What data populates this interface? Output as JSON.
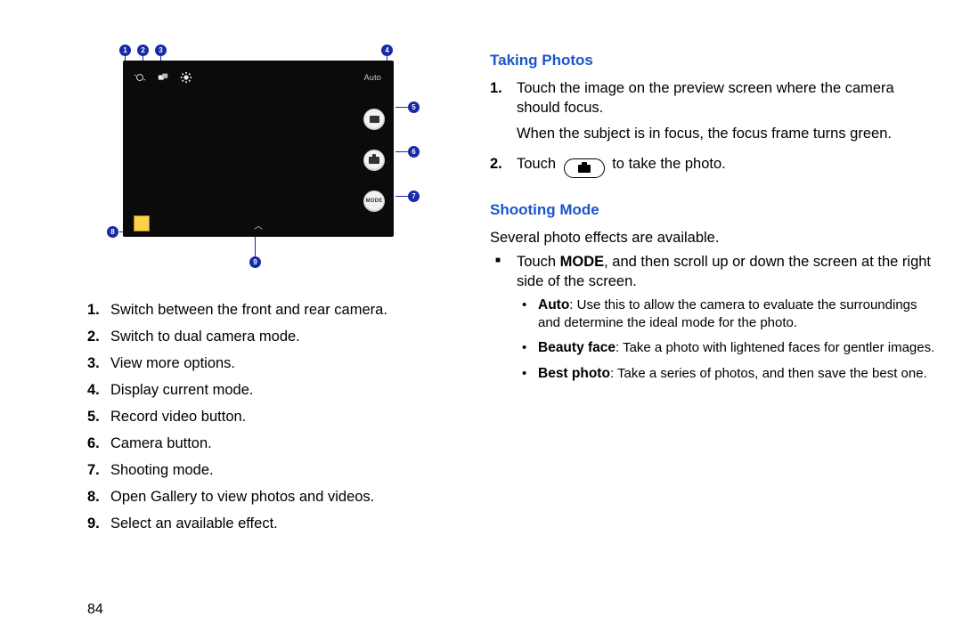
{
  "pageNumber": "84",
  "figure": {
    "modeLabel": "Auto",
    "callouts": [
      "1",
      "2",
      "3",
      "4",
      "5",
      "6",
      "7",
      "8",
      "9"
    ]
  },
  "legend": [
    "Switch between the front and rear camera.",
    "Switch to dual camera mode.",
    "View more options.",
    "Display current mode.",
    "Record video button.",
    "Camera button.",
    "Shooting mode.",
    "Open Gallery to view photos and videos.",
    "Select an available effect."
  ],
  "rightCol": {
    "takingPhotosHeading": "Taking Photos",
    "takingPhotos": {
      "item1a": "Touch the image on the preview screen where the camera should focus.",
      "item1b": "When the subject is in focus, the focus frame turns green.",
      "item2pre": "Touch",
      "item2post": "to take the photo."
    },
    "shootingModeHeading": "Shooting Mode",
    "shootingIntro": "Several photo effects are available.",
    "shootingBullet_pre": "Touch ",
    "shootingBullet_bold": "MODE",
    "shootingBullet_post": ", and then scroll up or down the screen at the right side of the screen.",
    "modes": [
      {
        "name": "Auto",
        "desc": ": Use this to allow the camera to evaluate the surroundings and determine the ideal mode for the photo."
      },
      {
        "name": "Beauty face",
        "desc": ": Take a photo with lightened faces for gentler images."
      },
      {
        "name": "Best photo",
        "desc": ": Take a series of photos, and then save the best one."
      }
    ]
  }
}
